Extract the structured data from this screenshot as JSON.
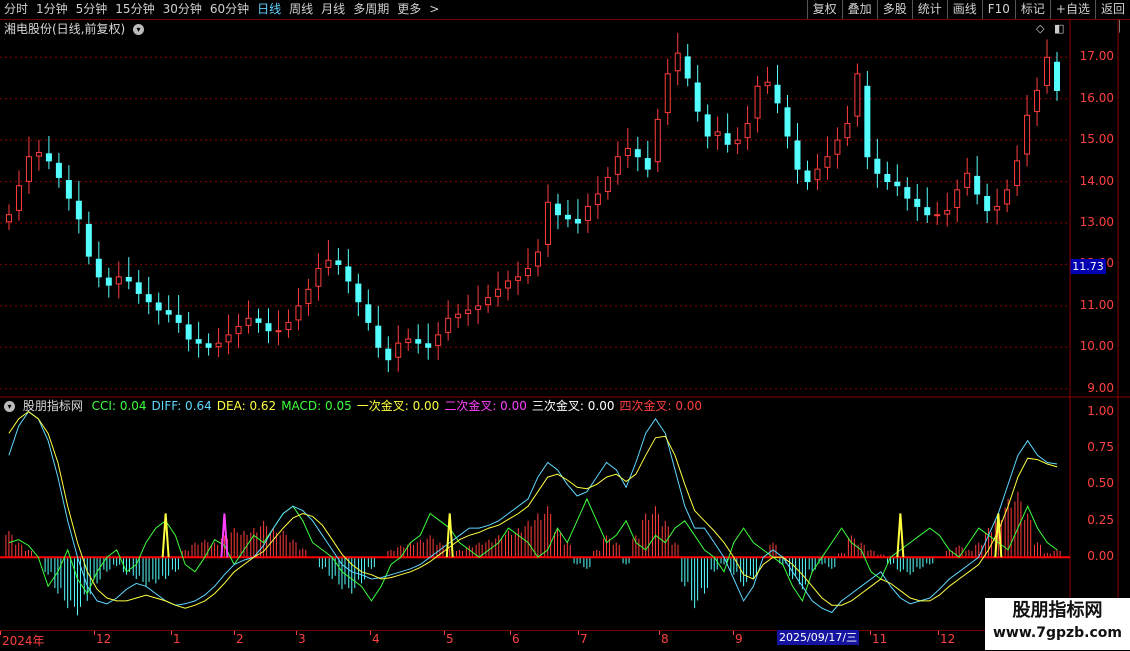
{
  "toolbar": {
    "periods": [
      {
        "label": "分时"
      },
      {
        "label": "1分钟"
      },
      {
        "label": "5分钟"
      },
      {
        "label": "15分钟"
      },
      {
        "label": "30分钟"
      },
      {
        "label": "60分钟"
      },
      {
        "label": "日线",
        "active": true
      },
      {
        "label": "周线"
      },
      {
        "label": "月线"
      },
      {
        "label": "多周期"
      },
      {
        "label": "更多"
      }
    ],
    "buttons": [
      {
        "label": "复权"
      },
      {
        "label": "叠加"
      },
      {
        "label": "多股"
      },
      {
        "label": "统计"
      },
      {
        "label": "画线"
      },
      {
        "label": "F10"
      },
      {
        "label": "标记"
      },
      {
        "label": "+自选"
      },
      {
        "label": "返回"
      }
    ]
  },
  "stock_title": "湘电股份(日线,前复权)",
  "price_axis": [
    "17.00",
    "16.00",
    "15.00",
    "14.00",
    "13.00",
    "12.00",
    "11.00",
    "10.00",
    "9.00"
  ],
  "current_price": "11.73",
  "indicator": {
    "name": "股朋指标网",
    "items": [
      {
        "label": "CCI: 0.04",
        "color": "#3cff3c"
      },
      {
        "label": "DIFF: 0.64",
        "color": "#5fd7ff"
      },
      {
        "label": "DEA: 0.62",
        "color": "#ffff40"
      },
      {
        "label": "MACD: 0.05",
        "color": "#3cff3c"
      },
      {
        "label": "一次金叉: 0.00",
        "color": "#ffff40"
      },
      {
        "label": "二次金叉: 0.00",
        "color": "#ff40ff"
      },
      {
        "label": "三次金叉: 0.00",
        "color": "#ffffff"
      },
      {
        "label": "四次金叉: 0.00",
        "color": "#ff4040"
      }
    ]
  },
  "indicator_axis": [
    "1.00",
    "0.75",
    "0.50",
    "0.25",
    "0.00"
  ],
  "date_axis": [
    "2024年",
    "12",
    "1",
    "2",
    "3",
    "4",
    "5",
    "6",
    "7",
    "8",
    "9",
    "11",
    "12"
  ],
  "selected_date": "2025/09/17/三",
  "watermark": {
    "line1": "股朋指标网",
    "line2": "www.7gpzb.com"
  },
  "colors": {
    "up": "#ff3c3c",
    "down": "#54ffff",
    "grid": "#8a0000",
    "zero_line": "#ff0000"
  },
  "chart_data": [
    {
      "type": "candlestick",
      "title": "湘电股份(日线,前复权)",
      "ylim": [
        8.8,
        17.9
      ],
      "x_labels": [
        "2024年",
        "12",
        "1",
        "2",
        "3",
        "4",
        "5",
        "6",
        "7",
        "8",
        "9",
        "11",
        "12"
      ],
      "close": [
        13.2,
        13.9,
        14.6,
        14.7,
        14.5,
        14.1,
        13.6,
        13.1,
        12.2,
        11.7,
        11.5,
        11.7,
        11.6,
        11.3,
        11.1,
        10.9,
        10.8,
        10.6,
        10.2,
        10.1,
        10.0,
        10.1,
        10.3,
        10.5,
        10.7,
        10.6,
        10.4,
        10.4,
        10.6,
        11.0,
        11.4,
        11.9,
        12.1,
        12.0,
        11.6,
        11.1,
        10.6,
        10.0,
        9.7,
        10.1,
        10.2,
        10.1,
        10.0,
        10.3,
        10.7,
        10.8,
        10.9,
        11.0,
        11.2,
        11.4,
        11.6,
        11.7,
        11.9,
        12.3,
        13.5,
        13.2,
        13.1,
        13.0,
        13.4,
        13.7,
        14.1,
        14.6,
        14.8,
        14.6,
        14.3,
        15.5,
        16.6,
        17.1,
        16.5,
        15.7,
        15.1,
        15.2,
        14.9,
        15.0,
        15.4,
        16.3,
        16.4,
        15.9,
        15.1,
        14.3,
        14.0,
        14.3,
        14.6,
        15.0,
        15.4,
        16.6,
        14.6,
        14.2,
        14.0,
        13.9,
        13.6,
        13.4,
        13.2,
        13.2,
        13.3,
        13.8,
        14.2,
        13.7,
        13.3,
        13.4,
        13.8,
        14.5,
        15.6,
        16.2,
        17.0,
        16.2
      ]
    },
    {
      "type": "line",
      "title": "股朋指标网",
      "ylim": [
        -0.5,
        1.1
      ],
      "series": [
        {
          "name": "CCI",
          "values": [
            0.1,
            0.12,
            0.08,
            0.0,
            -0.2,
            -0.1,
            0.05,
            -0.15,
            -0.25,
            -0.1,
            0.0,
            0.05,
            -0.1,
            -0.05,
            0.1,
            0.2,
            0.25,
            0.15,
            -0.05,
            -0.1,
            0.0,
            0.12,
            0.08,
            -0.05,
            0.05,
            0.15,
            0.1,
            0.2,
            0.3,
            0.35,
            0.25,
            0.1,
            0.05,
            0.0,
            -0.1,
            -0.15,
            -0.2,
            -0.3,
            -0.2,
            -0.05,
            0.0,
            0.1,
            0.15,
            0.3,
            0.25,
            0.2,
            0.1,
            0.05,
            0.0,
            0.05,
            0.1,
            0.2,
            0.15,
            0.1,
            0.0,
            0.05,
            0.2,
            0.1,
            0.25,
            0.4,
            0.25,
            0.1,
            0.15,
            0.25,
            0.1,
            0.05,
            0.15,
            0.1,
            0.2,
            0.25,
            0.15,
            0.05,
            0.0,
            -0.1,
            0.1,
            0.2,
            0.1,
            0.05,
            0.0,
            -0.05,
            -0.2,
            -0.3,
            -0.1,
            0.0,
            0.1,
            0.2,
            0.1,
            0.05,
            -0.1,
            -0.15,
            0.0,
            0.05,
            0.1,
            0.15,
            0.2,
            0.15,
            0.05,
            0.0,
            0.1,
            0.2,
            0.15,
            0.1,
            0.05,
            0.2,
            0.35,
            0.2,
            0.1,
            0.05
          ]
        },
        {
          "name": "DIFF",
          "values": [
            0.7,
            0.9,
            1.0,
            0.95,
            0.8,
            0.55,
            0.25,
            0.0,
            -0.2,
            -0.3,
            -0.32,
            -0.28,
            -0.22,
            -0.18,
            -0.2,
            -0.25,
            -0.3,
            -0.33,
            -0.32,
            -0.3,
            -0.26,
            -0.2,
            -0.12,
            -0.05,
            -0.02,
            0.0,
            0.08,
            0.2,
            0.3,
            0.35,
            0.32,
            0.25,
            0.15,
            0.05,
            -0.05,
            -0.1,
            -0.12,
            -0.15,
            -0.14,
            -0.12,
            -0.1,
            -0.08,
            -0.05,
            0.0,
            0.05,
            0.1,
            0.15,
            0.2,
            0.2,
            0.22,
            0.25,
            0.3,
            0.35,
            0.4,
            0.55,
            0.65,
            0.6,
            0.5,
            0.42,
            0.45,
            0.55,
            0.65,
            0.6,
            0.48,
            0.65,
            0.85,
            0.95,
            0.85,
            0.6,
            0.35,
            0.2,
            0.2,
            0.1,
            0.0,
            -0.15,
            -0.3,
            -0.2,
            0.0,
            0.05,
            0.0,
            -0.1,
            -0.2,
            -0.3,
            -0.35,
            -0.38,
            -0.3,
            -0.25,
            -0.2,
            -0.15,
            -0.1,
            -0.2,
            -0.28,
            -0.32,
            -0.3,
            -0.28,
            -0.22,
            -0.15,
            -0.1,
            -0.05,
            0.0,
            0.15,
            0.3,
            0.5,
            0.7,
            0.8,
            0.7,
            0.65,
            0.64
          ]
        },
        {
          "name": "DEA",
          "values": [
            0.85,
            0.95,
            1.0,
            0.95,
            0.85,
            0.65,
            0.35,
            0.1,
            -0.1,
            -0.22,
            -0.28,
            -0.3,
            -0.3,
            -0.28,
            -0.26,
            -0.28,
            -0.3,
            -0.33,
            -0.35,
            -0.33,
            -0.3,
            -0.25,
            -0.18,
            -0.1,
            -0.05,
            0.0,
            0.04,
            0.12,
            0.2,
            0.27,
            0.3,
            0.28,
            0.22,
            0.12,
            0.02,
            -0.05,
            -0.1,
            -0.12,
            -0.15,
            -0.14,
            -0.12,
            -0.1,
            -0.07,
            -0.03,
            0.02,
            0.07,
            0.12,
            0.15,
            0.17,
            0.2,
            0.22,
            0.26,
            0.3,
            0.35,
            0.45,
            0.55,
            0.57,
            0.53,
            0.48,
            0.47,
            0.5,
            0.55,
            0.57,
            0.52,
            0.57,
            0.7,
            0.82,
            0.83,
            0.7,
            0.5,
            0.32,
            0.25,
            0.18,
            0.1,
            0.0,
            -0.12,
            -0.15,
            -0.05,
            0.0,
            0.0,
            -0.05,
            -0.12,
            -0.2,
            -0.28,
            -0.33,
            -0.33,
            -0.3,
            -0.25,
            -0.2,
            -0.15,
            -0.18,
            -0.23,
            -0.28,
            -0.3,
            -0.3,
            -0.26,
            -0.2,
            -0.15,
            -0.1,
            -0.05,
            0.05,
            0.18,
            0.35,
            0.55,
            0.68,
            0.67,
            0.64,
            0.62
          ]
        },
        {
          "name": "MACD",
          "type": "bar",
          "values": [
            0.18,
            0.1,
            0.05,
            0.0,
            -0.12,
            -0.25,
            -0.35,
            -0.4,
            -0.3,
            -0.18,
            -0.1,
            -0.06,
            -0.12,
            -0.15,
            -0.2,
            -0.18,
            -0.15,
            -0.1,
            0.05,
            0.1,
            0.12,
            0.1,
            0.15,
            0.2,
            0.18,
            0.2,
            0.25,
            0.2,
            0.18,
            0.12,
            0.06,
            0.0,
            -0.08,
            -0.15,
            -0.22,
            -0.25,
            -0.18,
            -0.08,
            0.0,
            0.05,
            0.08,
            0.1,
            0.12,
            0.15,
            0.1,
            0.06,
            0.05,
            0.08,
            0.1,
            0.12,
            0.15,
            0.18,
            0.2,
            0.25,
            0.3,
            0.35,
            0.2,
            0.1,
            -0.05,
            -0.08,
            0.05,
            0.15,
            0.1,
            -0.05,
            0.15,
            0.3,
            0.35,
            0.25,
            0.1,
            -0.2,
            -0.35,
            -0.25,
            -0.1,
            -0.05,
            -0.12,
            -0.2,
            -0.15,
            0.0,
            0.1,
            -0.05,
            -0.15,
            -0.22,
            -0.1,
            -0.05,
            -0.08,
            0.03,
            0.15,
            0.1,
            0.05,
            0.02,
            -0.05,
            -0.1,
            -0.12,
            -0.08,
            -0.05,
            0.0,
            0.05,
            0.08,
            0.05,
            0.1,
            0.2,
            0.3,
            0.4,
            0.45,
            0.3,
            0.1,
            0.03,
            0.05
          ]
        }
      ],
      "spikes": [
        {
          "name": "一次金叉",
          "index": 16,
          "value": 0.3
        },
        {
          "name": "二次金叉",
          "index": 22,
          "value": 0.3
        },
        {
          "name": "一次金叉",
          "index": 45,
          "value": 0.3
        },
        {
          "name": "一次金叉",
          "index": 91,
          "value": 0.3
        },
        {
          "name": "一次金叉",
          "index": 101,
          "value": 0.3
        }
      ]
    }
  ]
}
